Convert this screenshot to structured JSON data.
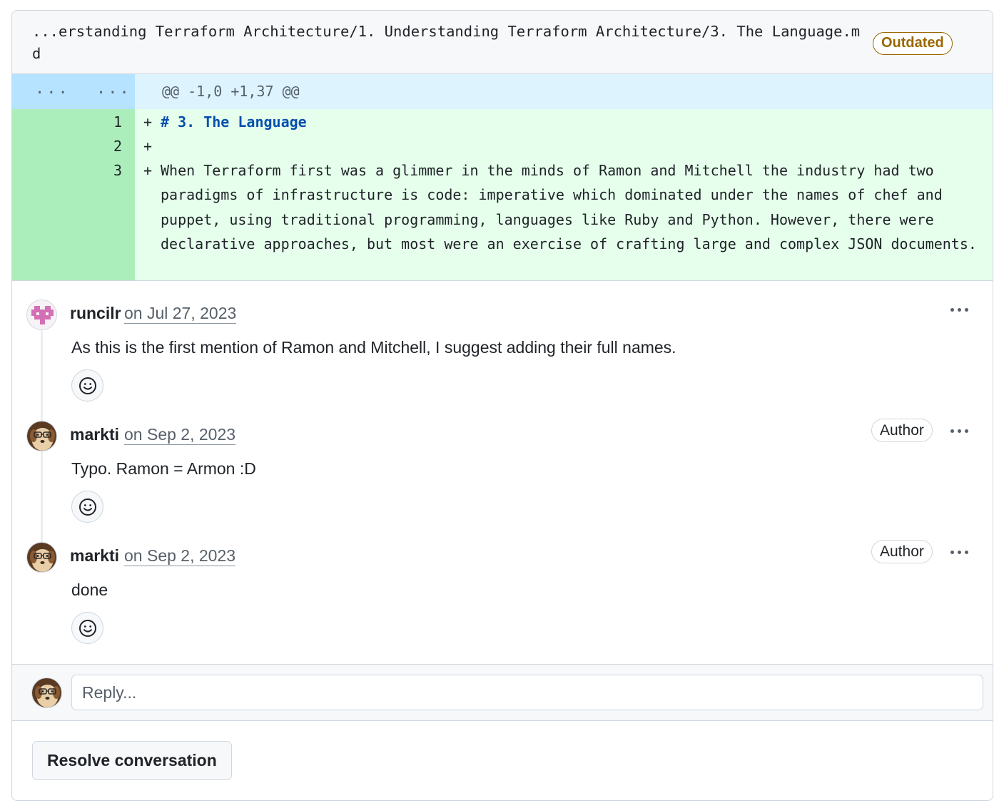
{
  "file": {
    "path": "...erstanding Terraform Architecture/1. Understanding Terraform Architecture/3. The Language.md",
    "status_badge": "Outdated"
  },
  "diff": {
    "hunk_left_marker": "...",
    "hunk_right_marker": "...",
    "hunk_header": "@@ -1,0 +1,37 @@",
    "lines": [
      {
        "num": "1",
        "marker": "+",
        "text": "# 3. The Language"
      },
      {
        "num": "2",
        "marker": "+",
        "text": ""
      },
      {
        "num": "3",
        "marker": "+",
        "text": "When Terraform first was a glimmer in the minds of Ramon and Mitchell the industry had two paradigms of infrastructure is code: imperative which dominated under the names of chef and puppet, using traditional programming, languages like Ruby and Python. However, there were declarative approaches, but most were an exercise of crafting large and complex JSON documents."
      }
    ]
  },
  "comments": [
    {
      "author": "runcilr",
      "date": "on Jul 27, 2023",
      "body": "As this is the first mention of Ramon and Mitchell, I suggest adding their full names.",
      "badge": "",
      "avatar_icon": "identicon-avatar"
    },
    {
      "author": "markti",
      "date": "on Sep 2, 2023",
      "body": "Typo. Ramon = Armon :D",
      "badge": "Author",
      "avatar_icon": "dog-avatar"
    },
    {
      "author": "markti",
      "date": "on Sep 2, 2023",
      "body": "done",
      "badge": "Author",
      "avatar_icon": "dog-avatar"
    }
  ],
  "reply": {
    "placeholder": "Reply..."
  },
  "actions": {
    "resolve_label": "Resolve conversation"
  },
  "colors": {
    "added_bg": "#e6ffec",
    "added_gutter": "#aceebb",
    "hunk_bg": "#ddf4ff",
    "hunk_gutter": "#b6e3ff",
    "outdated": "#9a6700",
    "heading": "#0550ae"
  }
}
